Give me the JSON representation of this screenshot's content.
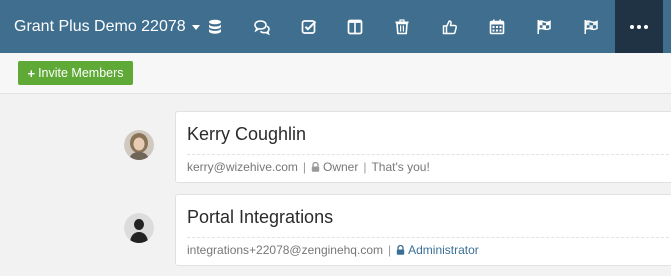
{
  "header": {
    "workspace_title": "Grant Plus Demo 22078",
    "tools": [
      {
        "name": "data-icon"
      },
      {
        "name": "discussions-icon"
      },
      {
        "name": "tasks-icon"
      },
      {
        "name": "layout-icon"
      },
      {
        "name": "trash-icon"
      },
      {
        "name": "thumbs-up-icon"
      },
      {
        "name": "calendar-icon"
      },
      {
        "name": "flag-icon"
      },
      {
        "name": "flag-alt-icon"
      }
    ],
    "more_icon": "ellipsis-icon"
  },
  "toolbar": {
    "invite_plus": "+",
    "invite_label": "Invite Members"
  },
  "members": [
    {
      "name": "Kerry Coughlin",
      "email": "kerry@wizehive.com",
      "role": "Owner",
      "note": "That's you!"
    },
    {
      "name": "Portal Integrations",
      "email": "integrations+22078@zenginehq.com",
      "role": "Administrator"
    }
  ],
  "colors": {
    "header_bg": "#3f6e8f",
    "more_bg": "#1f3344",
    "invite_bg": "#5fa936",
    "admin_role": "#3a6f95"
  }
}
